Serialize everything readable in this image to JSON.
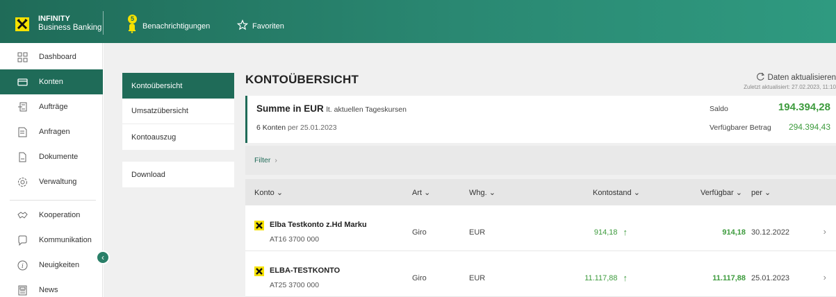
{
  "app": {
    "brand_line1": "INFINITY",
    "brand_line2": "Business Banking",
    "notifications_label": "Benachrichtigungen",
    "notifications_count": "5",
    "favorites_label": "Favoriten"
  },
  "sidebar": {
    "items": [
      {
        "label": "Dashboard",
        "icon": "grid-icon"
      },
      {
        "label": "Konten",
        "icon": "wallet-icon",
        "active": true
      },
      {
        "label": "Aufträge",
        "icon": "transfer-icon"
      },
      {
        "label": "Anfragen",
        "icon": "request-icon"
      },
      {
        "label": "Dokumente",
        "icon": "document-icon"
      },
      {
        "label": "Verwaltung",
        "icon": "gear-icon"
      },
      {
        "label": "Kooperation",
        "icon": "handshake-icon"
      },
      {
        "label": "Kommunikation",
        "icon": "chat-icon"
      },
      {
        "label": "Neuigkeiten",
        "icon": "info-icon"
      },
      {
        "label": "News",
        "icon": "newspaper-icon"
      }
    ]
  },
  "subnav": {
    "items": [
      "Kontoübersicht",
      "Umsatzübersicht",
      "Kontoauszug"
    ],
    "download": "Download"
  },
  "main": {
    "title": "KONTOÜBERSICHT",
    "refresh_label": "Daten aktualisieren",
    "last_updated": "Zuletzt aktualisiert: 27.02.2023, 11:10"
  },
  "summary": {
    "title": "Summe in EUR",
    "title_note": "lt. aktuellen Tageskursen",
    "accounts_count": "6 Konten",
    "per_date": "per 25.01.2023",
    "saldo_label": "Saldo",
    "saldo_value": "194.394,28",
    "available_label": "Verfügbarer Betrag",
    "available_value": "294.394,43"
  },
  "filter": {
    "label": "Filter"
  },
  "table": {
    "headers": {
      "konto": "Konto",
      "art": "Art",
      "whg": "Whg.",
      "kontostand": "Kontostand",
      "verfuegbar": "Verfügbar",
      "per": "per"
    },
    "rows": [
      {
        "name": "Elba Testkonto z.Hd Marku",
        "iban": "AT16 3700 000",
        "art": "Giro",
        "whg": "EUR",
        "kontostand": "914,18",
        "verfuegbar": "914,18",
        "per": "30.12.2022"
      },
      {
        "name": "ELBA-TESTKONTO",
        "iban": "AT25 3700 000",
        "art": "Giro",
        "whg": "EUR",
        "kontostand": "11.117,88",
        "verfuegbar": "11.117,88",
        "per": "25.01.2023"
      }
    ]
  },
  "colors": {
    "brand_green": "#1f6b58",
    "amount_green": "#3d9b3d",
    "logo_yellow": "#f5e100"
  }
}
